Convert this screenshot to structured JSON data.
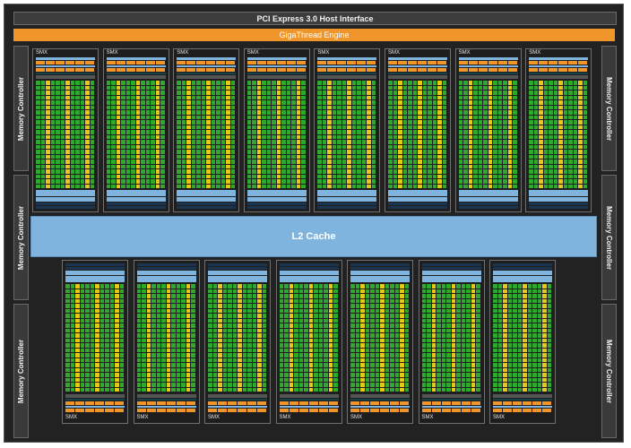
{
  "pcie_label": "PCI Express 3.0 Host Interface",
  "gigathread_label": "GigaThread Engine",
  "l2_label": "L2 Cache",
  "memory_controller_label": "Memory Controller",
  "smx_label": "SMX",
  "smx_top_count": 8,
  "smx_bottom_count": 7,
  "colors": {
    "die_bg": "#222222",
    "orange": "#f0952a",
    "cuda_core_green": "#2ea82e",
    "core_yellow": "#e6c817",
    "cache_blue": "#7fb4de",
    "dark_teal": "#17454f",
    "navy": "#1b3450",
    "gray_bar": "#555555"
  }
}
